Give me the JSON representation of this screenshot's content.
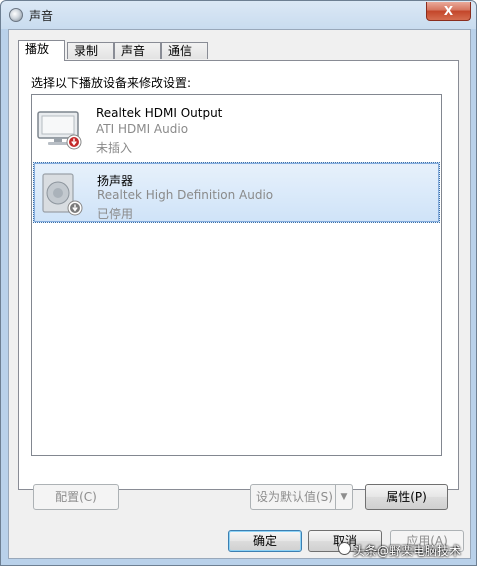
{
  "window": {
    "title": "声音",
    "close_symbol": "X"
  },
  "tabs": [
    {
      "label": "播放",
      "active": true
    },
    {
      "label": "录制",
      "active": false
    },
    {
      "label": "声音",
      "active": false
    },
    {
      "label": "通信",
      "active": false
    }
  ],
  "panel": {
    "instruction": "选择以下播放设备来修改设置:"
  },
  "devices": [
    {
      "name": "Realtek HDMI Output",
      "driver": "ATI HDMI Audio",
      "status": "未插入",
      "icon": "monitor-icon",
      "badge": "unplugged-badge",
      "selected": false
    },
    {
      "name": "扬声器",
      "driver": "Realtek High Definition Audio",
      "status": "已停用",
      "icon": "speaker-icon",
      "badge": "disabled-badge",
      "selected": true
    }
  ],
  "panel_buttons": {
    "configure": "配置(C)",
    "set_default": "设为默认值(S)",
    "properties": "属性(P)"
  },
  "dialog_buttons": {
    "ok": "确定",
    "cancel": "取消",
    "apply": "应用(A)"
  },
  "watermark": {
    "text": "头条@野栗电脑技术"
  },
  "colors": {
    "selection": "#cfe3f8",
    "titlebar": "#c9dcef",
    "close": "#c3462a"
  }
}
